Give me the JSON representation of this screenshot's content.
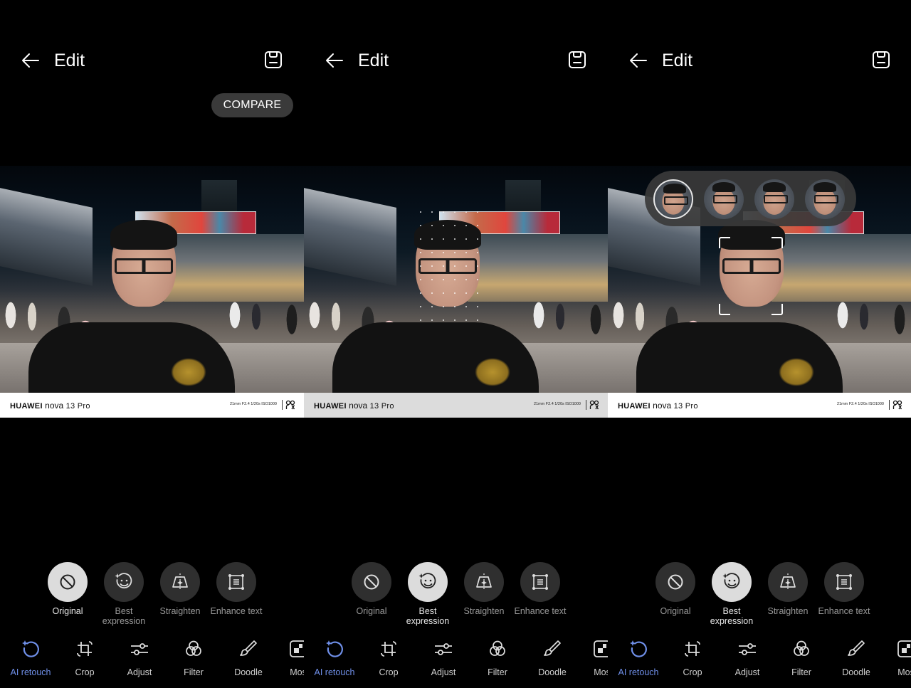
{
  "panels": [
    {
      "header": {
        "title": "Edit",
        "back_icon": "arrow-left-icon",
        "save_icon": "save-icon"
      },
      "compare_label": "COMPARE",
      "photo": {
        "caption": {
          "brand": "HUAWEI",
          "model": "nova",
          "variant": "13 Pro",
          "exif": "21mm  F2.4  1/20s  ISO1000"
        }
      },
      "active_option": "original"
    },
    {
      "header": {
        "title": "Edit",
        "back_icon": "arrow-left-icon",
        "save_icon": "save-icon"
      },
      "photo": {
        "caption": {
          "brand": "HUAWEI",
          "model": "nova",
          "variant": "13 Pro",
          "exif": "21mm  F2.4  1/20s  ISO1000"
        },
        "overlay": "face-landmark-dots"
      },
      "active_option": "best-expression"
    },
    {
      "header": {
        "title": "Edit",
        "back_icon": "arrow-left-icon",
        "save_icon": "save-icon"
      },
      "photo": {
        "caption": {
          "brand": "HUAWEI",
          "model": "nova",
          "variant": "13 Pro",
          "exif": "21mm  F2.4  1/20s  ISO1000"
        },
        "overlay": "face-selection-frame",
        "face_candidates": 4,
        "selected_candidate": 1
      },
      "active_option": "best-expression"
    }
  ],
  "ai_retouch_options": [
    {
      "id": "original",
      "label": "Original",
      "icon": "prohibited-icon"
    },
    {
      "id": "best-expression",
      "label": "Best expression",
      "icon": "sparkle-smiley-icon"
    },
    {
      "id": "straighten",
      "label": "Straighten",
      "icon": "straighten-icon"
    },
    {
      "id": "enhance-text",
      "label": "Enhance text",
      "icon": "document-frame-icon"
    }
  ],
  "toolbar": [
    {
      "id": "ai-retouch",
      "label": "AI retouch",
      "icon": "ai-retouch-icon",
      "active": true
    },
    {
      "id": "crop",
      "label": "Crop",
      "icon": "crop-icon"
    },
    {
      "id": "adjust",
      "label": "Adjust",
      "icon": "sliders-icon"
    },
    {
      "id": "filter",
      "label": "Filter",
      "icon": "filter-circles-icon"
    },
    {
      "id": "doodle",
      "label": "Doodle",
      "icon": "brush-icon"
    },
    {
      "id": "mosaic",
      "label": "Mos",
      "icon": "mosaic-icon"
    }
  ],
  "colors": {
    "accent": "#6f8fe8",
    "active_circle": "#dcdcdc",
    "inactive_circle": "#2f2f2f",
    "compare_bg": "#3a3a3a"
  }
}
